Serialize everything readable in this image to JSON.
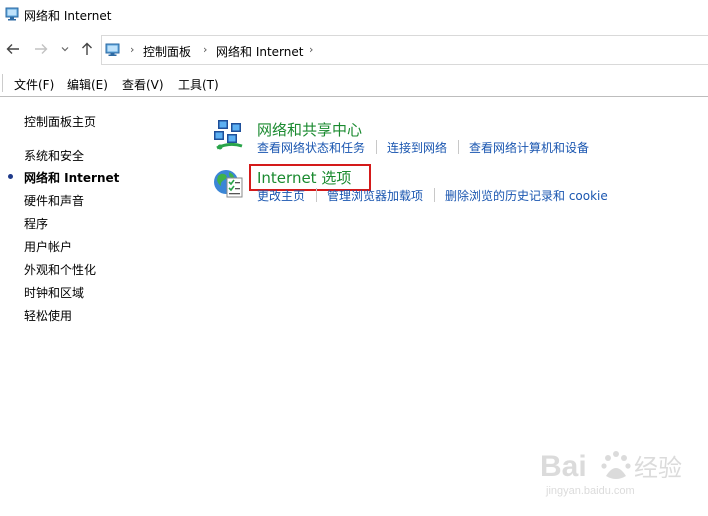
{
  "window": {
    "title": "网络和 Internet"
  },
  "nav": {
    "back_icon": "arrow-left-icon",
    "forward_icon": "arrow-right-icon",
    "recent_icon": "chevron-down-icon",
    "up_icon": "arrow-up-icon"
  },
  "breadcrumb": {
    "items": [
      "控制面板",
      "网络和 Internet"
    ],
    "separator": "›"
  },
  "menu": {
    "items": [
      "文件(F)",
      "编辑(E)",
      "查看(V)",
      "工具(T)"
    ]
  },
  "sidebar": {
    "home": "控制面板主页",
    "items": [
      {
        "label": "系统和安全",
        "current": false
      },
      {
        "label": "网络和 Internet",
        "current": true
      },
      {
        "label": "硬件和声音",
        "current": false
      },
      {
        "label": "程序",
        "current": false
      },
      {
        "label": "用户帐户",
        "current": false
      },
      {
        "label": "外观和个性化",
        "current": false
      },
      {
        "label": "时钟和区域",
        "current": false
      },
      {
        "label": "轻松使用",
        "current": false
      }
    ]
  },
  "categories": [
    {
      "title": "网络和共享中心",
      "icon": "network-sharing-icon",
      "links": [
        "查看网络状态和任务",
        "连接到网络",
        "查看网络计算机和设备"
      ]
    },
    {
      "title": "Internet 选项",
      "icon": "internet-options-icon",
      "highlighted": true,
      "links": [
        "更改主页",
        "管理浏览器加载项",
        "删除浏览的历史记录和 cookie"
      ]
    }
  ],
  "colors": {
    "category_title": "#1a8a2f",
    "link": "#1a56b0",
    "highlight_border": "#d41a1a"
  }
}
